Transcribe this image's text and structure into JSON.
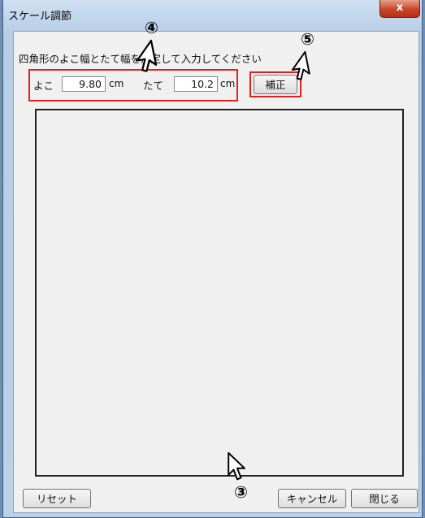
{
  "window": {
    "title": "スケール調節",
    "close_glyph": "x"
  },
  "instruction": "四角形のよこ幅とたて幅を測定して入力してください",
  "width_field": {
    "label": "よこ",
    "value": "9.80",
    "unit": "cm"
  },
  "height_field": {
    "label": "たて",
    "value": "10.2",
    "unit": "cm"
  },
  "buttons": {
    "correct": "補正",
    "reset": "リセット",
    "cancel": "キャンセル",
    "close": "閉じる"
  },
  "annotations": {
    "step3": "③",
    "step4": "④",
    "step5": "⑤",
    "highlight_color": "#e0201e"
  },
  "icons": [
    "cursor-arrow-icon",
    "close-icon"
  ]
}
